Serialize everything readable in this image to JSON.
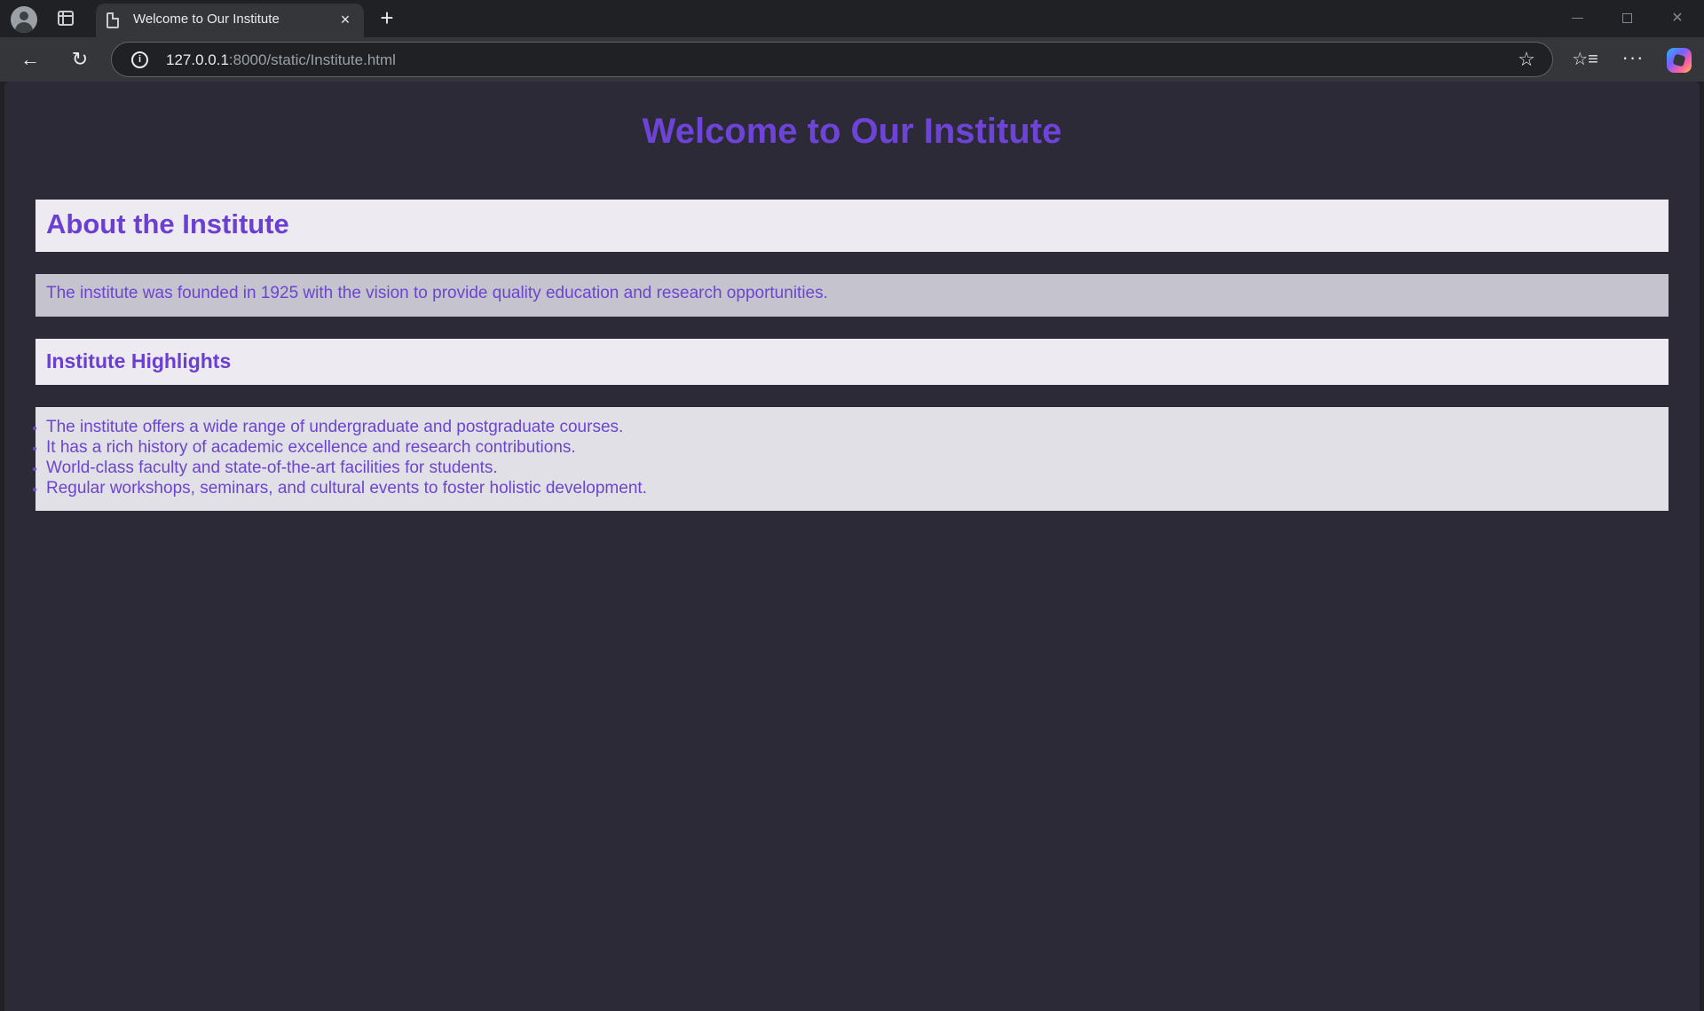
{
  "browser": {
    "tab_title": "Welcome to Our Institute",
    "tab_close": "×",
    "new_tab": "+",
    "url_host": "127.0.0.1",
    "url_path": ":8000/static/Institute.html",
    "icons": {
      "profile": "profile-avatar-icon",
      "tab_actions": "tab-actions-icon",
      "page": "page-icon",
      "back": "back-arrow-icon",
      "reload": "reload-icon",
      "info": "site-info-icon",
      "star": "star-icon",
      "favorites": "favorites-icon",
      "more": "more-icon",
      "copilot": "copilot-icon"
    },
    "glyphs": {
      "back": "←",
      "reload": "↻",
      "info": "i",
      "star": "☆",
      "favorites": "☆≡",
      "more": "···",
      "close": "✕"
    }
  },
  "page": {
    "title": "Welcome to Our Institute",
    "about": {
      "heading": "About the Institute",
      "text": "The institute was founded in 1925 with the vision to provide quality education and research opportunities."
    },
    "highlights": {
      "heading": "Institute Highlights",
      "items": [
        "The institute offers a wide range of undergraduate and postgraduate courses.",
        "It has a rich history of academic excellence and research contributions.",
        "World-class faculty and state-of-the-art facilities for students.",
        "Regular workshops, seminars, and cultural events to foster holistic development."
      ]
    }
  },
  "colors": {
    "accent": "#6a3fd1",
    "page_background": "#2c2a37",
    "chrome_dark": "#202124",
    "chrome_toolbar": "#35363a"
  }
}
